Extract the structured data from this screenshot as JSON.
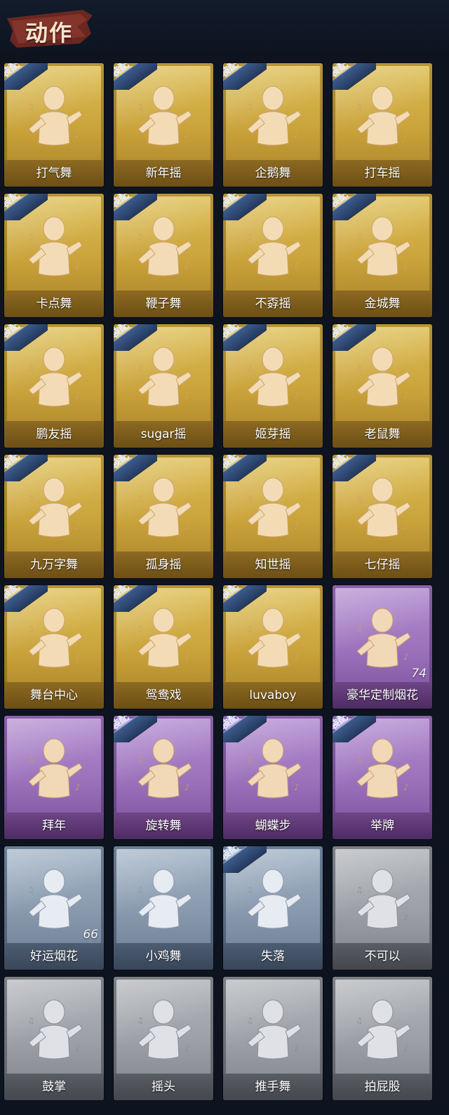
{
  "header": {
    "title": "动作"
  },
  "badge_text": "装配",
  "colors": {
    "gold": "#c9a23a",
    "purple": "#9a70ba",
    "blue": "#8798ad",
    "gray": "#9b9ea4",
    "badge": "#2f4a76",
    "background": "#0d1420"
  },
  "actions": [
    {
      "label": "打气舞",
      "tier": "gold",
      "equipped": true,
      "icon": "dancer-figure-icon"
    },
    {
      "label": "新年摇",
      "tier": "gold",
      "equipped": true,
      "icon": "dancer-figure-icon"
    },
    {
      "label": "企鹅舞",
      "tier": "gold",
      "equipped": true,
      "icon": "dancer-figure-icon"
    },
    {
      "label": "打车摇",
      "tier": "gold",
      "equipped": true,
      "icon": "dancer-figure-icon"
    },
    {
      "label": "卡点舞",
      "tier": "gold",
      "equipped": true,
      "icon": "dancer-figure-icon"
    },
    {
      "label": "鞭子舞",
      "tier": "gold",
      "equipped": true,
      "icon": "dancer-figure-icon"
    },
    {
      "label": "不孬摇",
      "tier": "gold",
      "equipped": true,
      "icon": "dancer-figure-icon"
    },
    {
      "label": "金城舞",
      "tier": "gold",
      "equipped": true,
      "icon": "dancer-figure-icon"
    },
    {
      "label": "鹏友摇",
      "tier": "gold",
      "equipped": true,
      "icon": "dancer-figure-icon"
    },
    {
      "label": "sugar摇",
      "tier": "gold",
      "equipped": true,
      "icon": "dancer-figure-icon"
    },
    {
      "label": "姬芽摇",
      "tier": "gold",
      "equipped": true,
      "icon": "dancer-figure-icon"
    },
    {
      "label": "老鼠舞",
      "tier": "gold",
      "equipped": true,
      "icon": "dancer-figure-icon"
    },
    {
      "label": "九万字舞",
      "tier": "gold",
      "equipped": true,
      "icon": "dancer-figure-icon"
    },
    {
      "label": "孤身摇",
      "tier": "gold",
      "equipped": true,
      "icon": "dancer-figure-icon"
    },
    {
      "label": "知世摇",
      "tier": "gold",
      "equipped": true,
      "icon": "dancer-figure-icon"
    },
    {
      "label": "七仔摇",
      "tier": "gold",
      "equipped": true,
      "icon": "dancer-figure-icon"
    },
    {
      "label": "舞台中心",
      "tier": "gold",
      "equipped": true,
      "icon": "dancer-figure-icon"
    },
    {
      "label": "鸳鸯戏",
      "tier": "gold",
      "equipped": true,
      "icon": "dancer-figure-icon"
    },
    {
      "label": "luvaboy",
      "tier": "gold",
      "equipped": true,
      "icon": "dancer-figure-icon"
    },
    {
      "label": "豪华定制烟花",
      "tier": "purple",
      "equipped": false,
      "icon": "fireworks-box-icon",
      "count": "74"
    },
    {
      "label": "拜年",
      "tier": "purple",
      "equipped": false,
      "icon": "bowing-figure-icon"
    },
    {
      "label": "旋转舞",
      "tier": "purple",
      "equipped": true,
      "icon": "spinning-figure-icon"
    },
    {
      "label": "蝴蝶步",
      "tier": "purple",
      "equipped": true,
      "icon": "dancer-figure-icon"
    },
    {
      "label": "举牌",
      "tier": "purple",
      "equipped": true,
      "icon": "sign-holding-icon"
    },
    {
      "label": "好运烟花",
      "tier": "blue",
      "equipped": false,
      "icon": "firework-can-icon",
      "count": "66"
    },
    {
      "label": "小鸡舞",
      "tier": "blue",
      "equipped": false,
      "icon": "chicken-dance-icon"
    },
    {
      "label": "失落",
      "tier": "blue",
      "equipped": true,
      "icon": "crawling-figure-icon"
    },
    {
      "label": "不可以",
      "tier": "gray",
      "equipped": false,
      "icon": "finger-wag-icon"
    },
    {
      "label": "鼓掌",
      "tier": "gray",
      "equipped": false,
      "icon": "clapping-hands-icon"
    },
    {
      "label": "摇头",
      "tier": "gray",
      "equipped": false,
      "icon": "head-shake-icon"
    },
    {
      "label": "推手舞",
      "tier": "gray",
      "equipped": false,
      "icon": "push-hands-icon"
    },
    {
      "label": "拍屁股",
      "tier": "gray",
      "equipped": false,
      "icon": "butt-slap-icon"
    }
  ]
}
